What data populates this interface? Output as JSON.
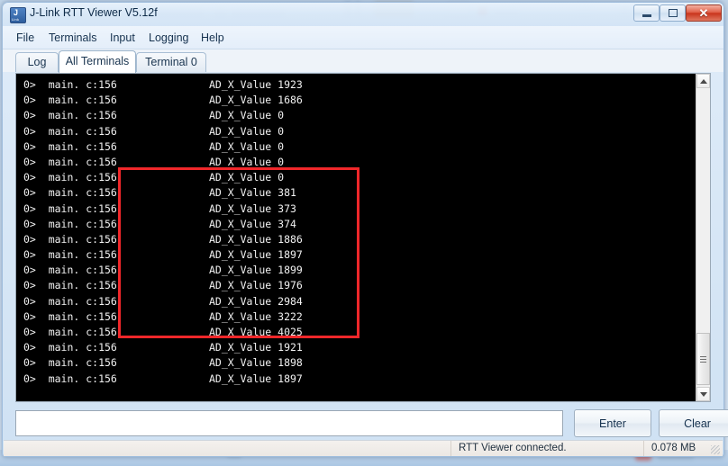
{
  "window": {
    "title": "J-Link RTT Viewer V5.12f",
    "icon": "jlink-icon",
    "controls": {
      "minimize": "minimize-icon",
      "maximize": "maximize-icon",
      "close": "✕"
    }
  },
  "menu": {
    "items": [
      {
        "label": "File"
      },
      {
        "label": "Terminals"
      },
      {
        "label": "Input"
      },
      {
        "label": "Logging"
      },
      {
        "label": "Help"
      }
    ]
  },
  "tabs": {
    "items": [
      {
        "label": "Log",
        "active": false
      },
      {
        "label": "All Terminals",
        "active": true
      },
      {
        "label": "Terminal 0",
        "active": false
      }
    ]
  },
  "terminal": {
    "prefix": "0>  main. c:156",
    "label": "AD_X_Value",
    "lines": [
      {
        "source": "0>  main. c:156",
        "key": "AD_X_Value",
        "value": "1923"
      },
      {
        "source": "0>  main. c:156",
        "key": "AD_X_Value",
        "value": "1686"
      },
      {
        "source": "0>  main. c:156",
        "key": "AD_X_Value",
        "value": "0"
      },
      {
        "source": "0>  main. c:156",
        "key": "AD_X_Value",
        "value": "0"
      },
      {
        "source": "0>  main. c:156",
        "key": "AD_X_Value",
        "value": "0"
      },
      {
        "source": "0>  main. c:156",
        "key": "AD_X_Value",
        "value": "0"
      },
      {
        "source": "0>  main. c:156",
        "key": "AD_X_Value",
        "value": "0"
      },
      {
        "source": "0>  main. c:156",
        "key": "AD_X_Value",
        "value": "381"
      },
      {
        "source": "0>  main. c:156",
        "key": "AD_X_Value",
        "value": "373"
      },
      {
        "source": "0>  main. c:156",
        "key": "AD_X_Value",
        "value": "374"
      },
      {
        "source": "0>  main. c:156",
        "key": "AD_X_Value",
        "value": "1886"
      },
      {
        "source": "0>  main. c:156",
        "key": "AD_X_Value",
        "value": "1897"
      },
      {
        "source": "0>  main. c:156",
        "key": "AD_X_Value",
        "value": "1899"
      },
      {
        "source": "0>  main. c:156",
        "key": "AD_X_Value",
        "value": "1976"
      },
      {
        "source": "0>  main. c:156",
        "key": "AD_X_Value",
        "value": "2984"
      },
      {
        "source": "0>  main. c:156",
        "key": "AD_X_Value",
        "value": "3222"
      },
      {
        "source": "0>  main. c:156",
        "key": "AD_X_Value",
        "value": "4025"
      },
      {
        "source": "0>  main. c:156",
        "key": "AD_X_Value",
        "value": "1921"
      },
      {
        "source": "0>  main. c:156",
        "key": "AD_X_Value",
        "value": "1898"
      },
      {
        "source": "0>  main. c:156",
        "key": "AD_X_Value",
        "value": "1897"
      }
    ],
    "highlight": {
      "color": "#f0272a",
      "first_line_index": 6,
      "last_line_index": 16
    },
    "background": "#000000",
    "text_color": "#f2f2f2"
  },
  "input": {
    "value": "",
    "placeholder": ""
  },
  "buttons": {
    "enter": "Enter",
    "clear": "Clear"
  },
  "status": {
    "connection": "RTT Viewer connected.",
    "data_size": "0.078 MB"
  },
  "scrollbar": {
    "up": "scroll-up-icon",
    "down": "scroll-down-icon"
  }
}
